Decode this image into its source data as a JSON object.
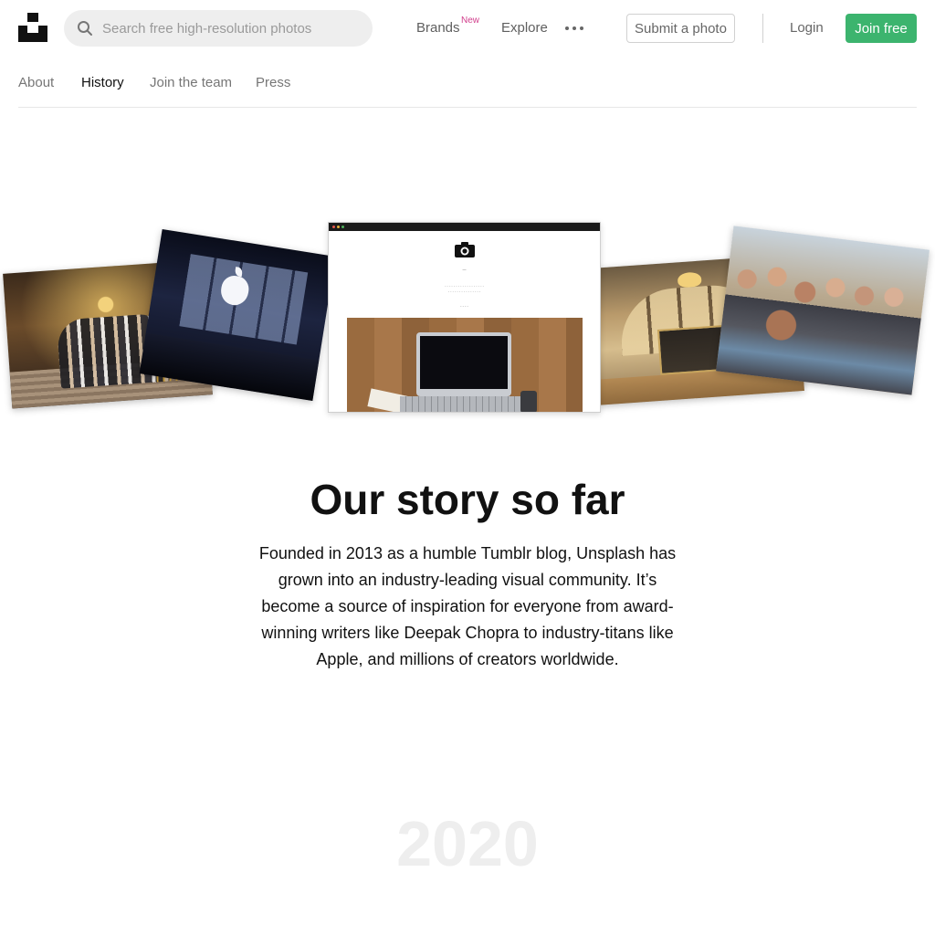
{
  "header": {
    "search_placeholder": "Search free high-resolution photos",
    "brands_label": "Brands",
    "new_badge": "New",
    "explore_label": "Explore",
    "submit_label": "Submit a photo",
    "login_label": "Login",
    "join_label": "Join free"
  },
  "subnav": {
    "items": [
      {
        "label": "About",
        "active": false
      },
      {
        "label": "History",
        "active": true
      },
      {
        "label": "Join the team",
        "active": false
      },
      {
        "label": "Press",
        "active": false
      }
    ]
  },
  "collage": {
    "photos": [
      "group photo on staircase",
      "apple store glass",
      "website screenshot",
      "office interior",
      "team selfie"
    ]
  },
  "story": {
    "title": "Our story so far",
    "text": "Founded in 2013 as a humble Tumblr blog, Unsplash has grown into an industry-leading visual community. It’s become a source of inspiration for everyone from award-winning writers like Deepak Chopra to industry-titans like Apple, and millions of creators worldwide."
  },
  "timeline": {
    "year": "2020"
  },
  "colors": {
    "accent": "#3cb46e",
    "new_badge": "#d13f8c"
  }
}
